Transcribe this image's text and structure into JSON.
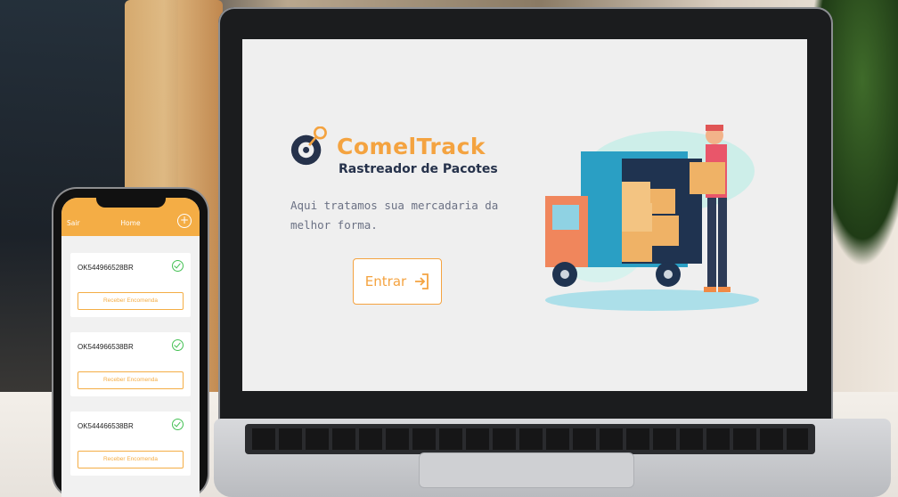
{
  "laptop_app": {
    "brand_name": "ComelTrack",
    "brand_subtitle": "Rastreador de Pacotes",
    "tagline": "Aqui tratamos sua mercadaria da melhor forma.",
    "enter_button": "Entrar",
    "accent_color": "#f4a340",
    "dark_color": "#26324b"
  },
  "mobile_app": {
    "header": {
      "left_action": "Sair",
      "title": "Home",
      "add_icon": "plus-circle-icon"
    },
    "orders": [
      {
        "code": "OK544966528BR",
        "status_icon": "check-circle-icon",
        "button": "Receber Encomenda"
      },
      {
        "code": "OK544966538BR",
        "status_icon": "check-circle-icon",
        "button": "Receber Encomenda"
      },
      {
        "code": "OK544466538BR",
        "status_icon": "check-circle-icon",
        "button": "Receber Encomenda"
      }
    ],
    "header_color": "#f4ad45",
    "status_color": "#43c053"
  }
}
